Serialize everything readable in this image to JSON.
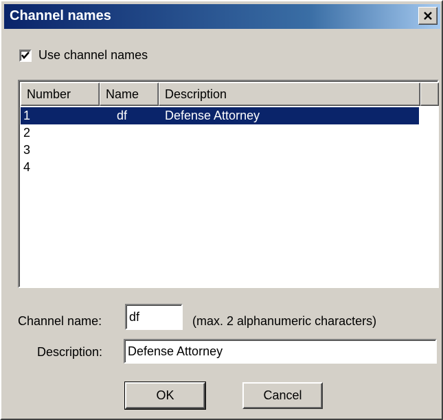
{
  "window": {
    "title": "Channel names",
    "close_glyph": "✕"
  },
  "use_names": {
    "label": "Use channel names",
    "checked": true
  },
  "list": {
    "columns": [
      "Number",
      "Name",
      "Description"
    ],
    "rows": [
      {
        "number": "1",
        "name": "df",
        "description": "Defense Attorney",
        "selected": true
      },
      {
        "number": "2",
        "name": "",
        "description": "",
        "selected": false
      },
      {
        "number": "3",
        "name": "",
        "description": "",
        "selected": false
      },
      {
        "number": "4",
        "name": "",
        "description": "",
        "selected": false
      }
    ]
  },
  "form": {
    "channel_name_label": "Channel name:",
    "channel_name_value": "df",
    "channel_name_hint": "(max. 2 alphanumeric characters)",
    "description_label": "Description:",
    "description_value": "Defense Attorney"
  },
  "buttons": {
    "ok": "OK",
    "cancel": "Cancel"
  },
  "colors": {
    "title_gradient_start": "#0a246a",
    "title_gradient_end": "#a6caf0",
    "selection": "#0a246a",
    "face": "#d4d0c8"
  }
}
